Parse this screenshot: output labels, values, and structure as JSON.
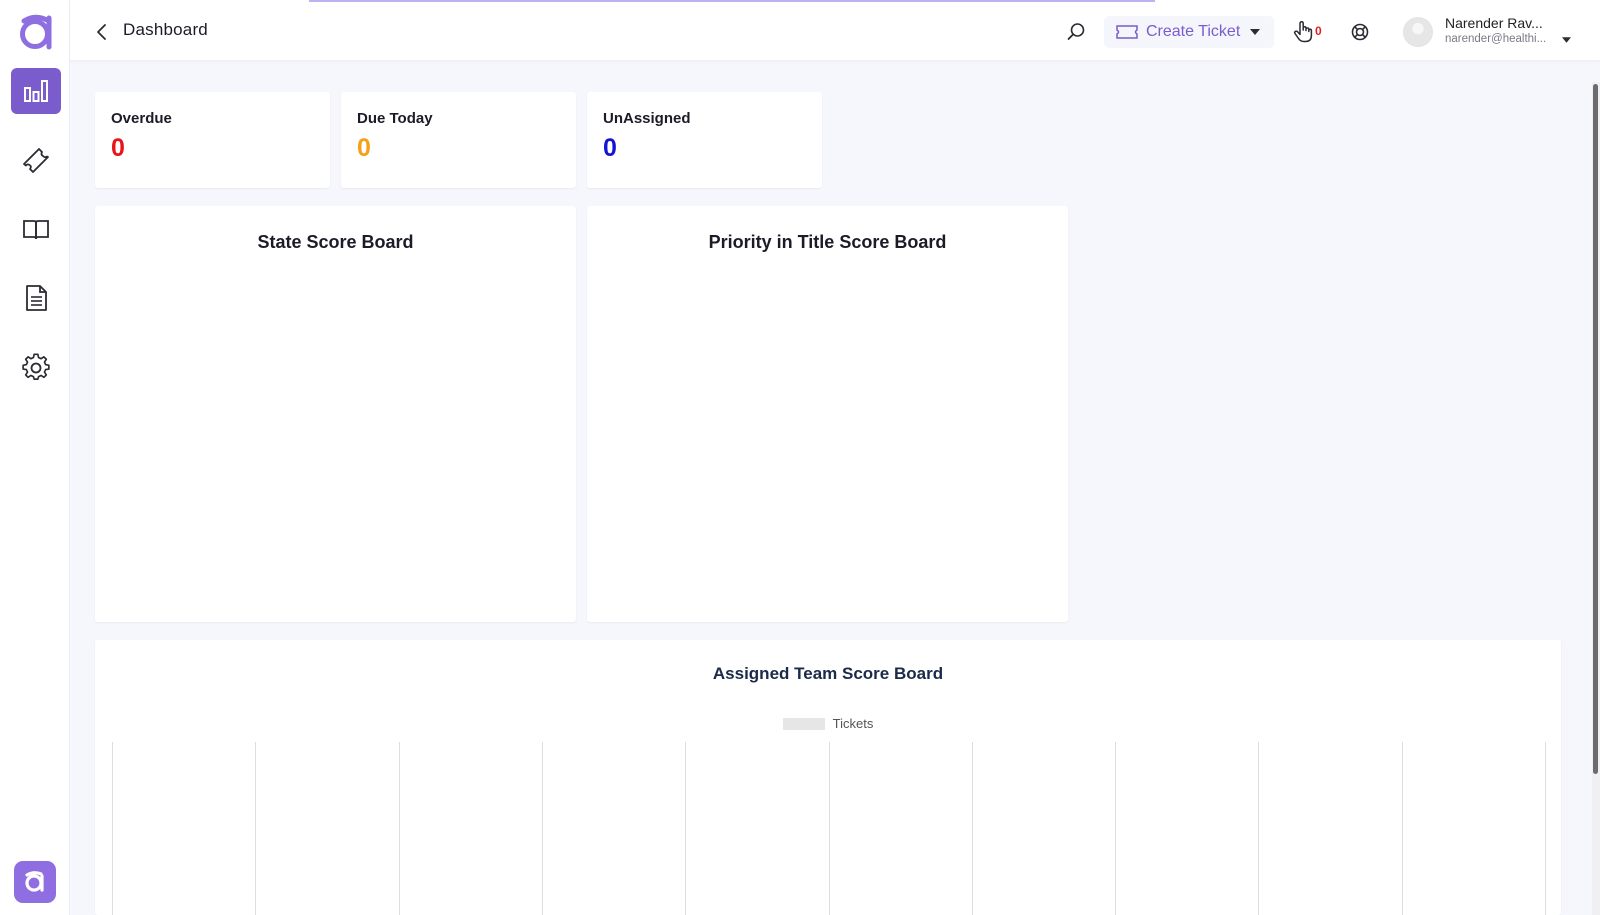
{
  "header": {
    "title": "Dashboard",
    "create_ticket_label": "Create Ticket",
    "hand_count": "0",
    "user_name": "Narender Rav...",
    "user_email": "narender@healthi..."
  },
  "sidebar": {
    "items": [
      {
        "name": "dashboard",
        "icon": "bar-chart-icon",
        "active": true
      },
      {
        "name": "tickets",
        "icon": "ticket-icon",
        "active": false
      },
      {
        "name": "knowledge-base",
        "icon": "book-icon",
        "active": false
      },
      {
        "name": "reports",
        "icon": "document-icon",
        "active": false
      },
      {
        "name": "settings",
        "icon": "gear-icon",
        "active": false
      }
    ]
  },
  "stats": [
    {
      "label": "Overdue",
      "value": "0",
      "color": "#e8141c"
    },
    {
      "label": "Due Today",
      "value": "0",
      "color": "#f5a018"
    },
    {
      "label": "UnAssigned",
      "value": "0",
      "color": "#1414d6"
    }
  ],
  "boards": {
    "state_title": "State Score Board",
    "priority_title": "Priority in Title Score Board",
    "team_title": "Assigned Team Score Board"
  },
  "chart_data": {
    "type": "bar",
    "title": "Assigned Team Score Board",
    "series": [
      {
        "name": "Tickets",
        "values": []
      }
    ],
    "categories": [],
    "grid": true,
    "legend": "top"
  },
  "colors": {
    "accent": "#7a5ccd",
    "overdue": "#e8141c",
    "due_today": "#f5a018",
    "unassigned": "#1414d6"
  }
}
